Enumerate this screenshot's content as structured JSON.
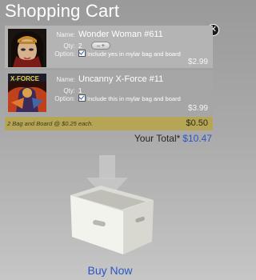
{
  "header": {
    "title": "Shopping Cart"
  },
  "labels": {
    "name": "Name:",
    "qty": "Qty:",
    "option": "Option:"
  },
  "items": [
    {
      "name": "Wonder Woman #611",
      "qty": "2",
      "option_text": "Include yes in mylar bag and board",
      "price": "$2.99"
    },
    {
      "name": "Uncanny X-Force #11",
      "qty": "1",
      "option_text": "Include this in mylar bag and board",
      "price": "$3.99"
    }
  ],
  "bag_row": {
    "text": "2 Bag and Board @ $0.25 each.",
    "price": "$0.50"
  },
  "total": {
    "label": "Your Total*",
    "amount": "$10.47"
  },
  "actions": {
    "buy_now": "Buy Now"
  },
  "icons": {
    "close": "close-icon",
    "checkbox": "checkbox-icon",
    "arrow": "down-arrow-icon",
    "box": "storage-box-icon"
  },
  "colors": {
    "accent": "#2c56c7",
    "bag_row": "#b5a554"
  }
}
